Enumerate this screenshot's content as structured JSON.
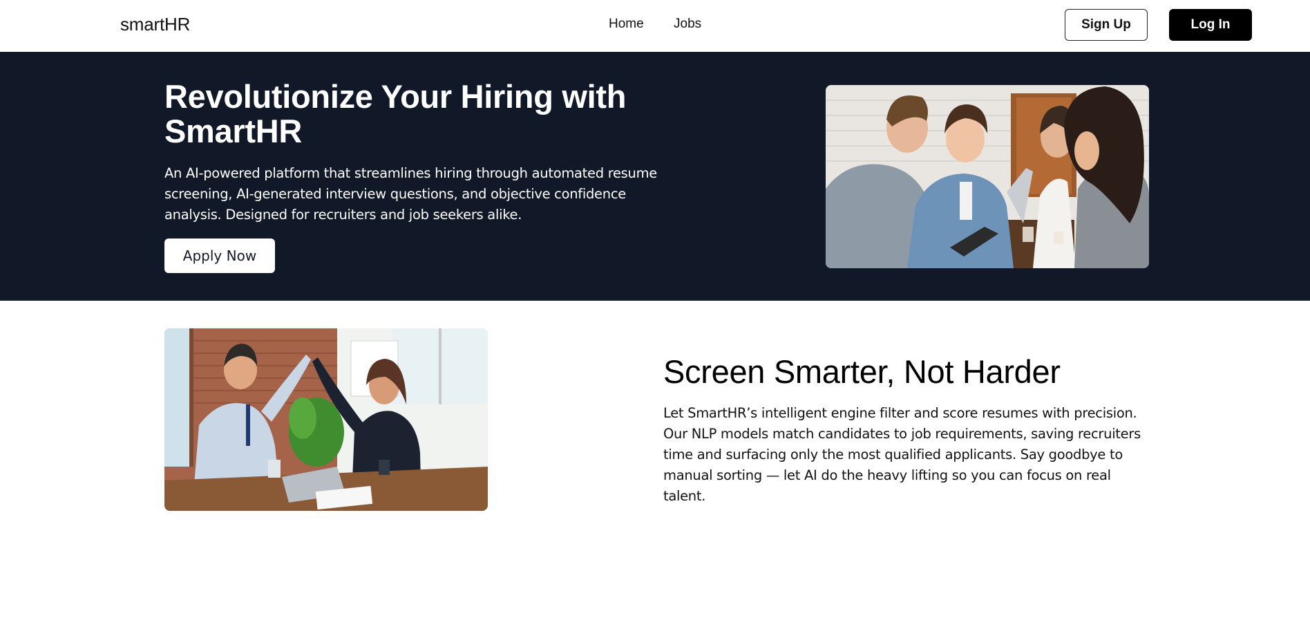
{
  "nav": {
    "logo": "smartHR",
    "links": [
      {
        "label": "Home"
      },
      {
        "label": "Jobs"
      }
    ],
    "signup_label": "Sign Up",
    "login_label": "Log In"
  },
  "hero": {
    "title": "Revolutionize Your Hiring with SmartHR",
    "description": "An AI-powered platform that streamlines hiring through automated resume screening, AI-generated interview questions, and objective confidence analysis. Designed for recruiters and job seekers alike.",
    "cta_label": "Apply Now",
    "background_color": "#111827"
  },
  "feature": {
    "title": "Screen Smarter, Not Harder",
    "description": "Let SmartHR’s intelligent engine filter and score resumes with precision. Our NLP models match candidates to job requirements, saving recruiters time and surfacing only the most qualified applicants. Say goodbye to manual sorting — let AI do the heavy lifting so you can focus on real talent."
  },
  "colors": {
    "dark": "#111827",
    "primary_button": "#000000",
    "white": "#ffffff"
  }
}
